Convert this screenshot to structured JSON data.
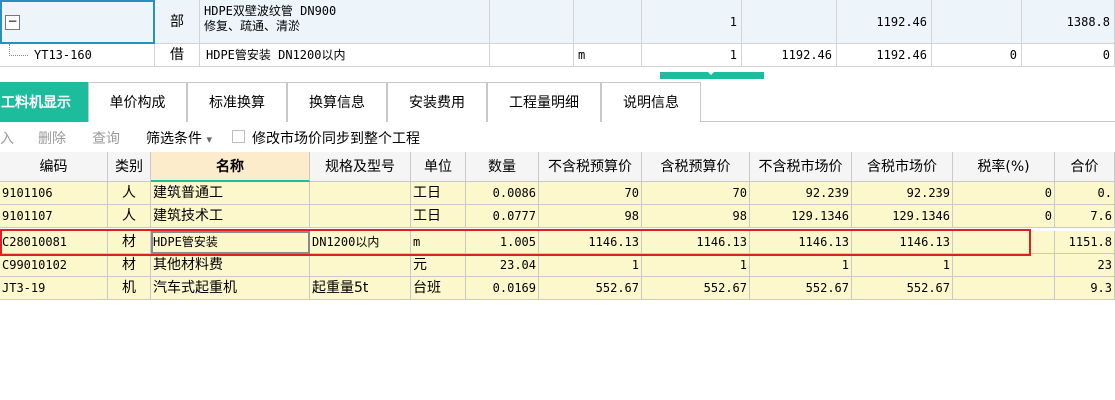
{
  "top_grid": {
    "row1": {
      "expander": "−",
      "type": "部",
      "name_line1": "HDPE双壁波纹管 DN900",
      "name_line2": "修复、疏通、清淤",
      "quantity": "1",
      "value_a": "1192.46",
      "value_b": "1388.8"
    },
    "row2": {
      "code": "YT13-160",
      "type": "借",
      "name": "HDPE管安装 DN1200以内",
      "unit": "m",
      "quantity": "1",
      "price1": "1192.46",
      "price2": "1192.46",
      "zero1": "0",
      "zero2": "0"
    }
  },
  "tabs": [
    {
      "label": "工料机显示",
      "active": true
    },
    {
      "label": "单价构成"
    },
    {
      "label": "标准换算"
    },
    {
      "label": "换算信息"
    },
    {
      "label": "安装费用"
    },
    {
      "label": "工程量明细"
    },
    {
      "label": "说明信息"
    }
  ],
  "toolbar": {
    "insert": "入",
    "delete": "删除",
    "query": "查询",
    "filter": "筛选条件",
    "filter_arrow": "▾",
    "sync_label": "修改市场价同步到整个工程"
  },
  "columns": [
    "编码",
    "类别",
    "名称",
    "规格及型号",
    "单位",
    "数量",
    "不含税预算价",
    "含税预算价",
    "不含税市场价",
    "含税市场价",
    "税率(%)",
    "合价"
  ],
  "rows": [
    {
      "code": "9101106",
      "type": "人",
      "name": "建筑普通工",
      "spec": "",
      "unit": "工日",
      "qty": "0.0086",
      "p1": "70",
      "p2": "70",
      "p3": "92.239",
      "p4": "92.239",
      "tax": "0",
      "total": "0."
    },
    {
      "code": "9101107",
      "type": "人",
      "name": "建筑技术工",
      "spec": "",
      "unit": "工日",
      "qty": "0.0777",
      "p1": "98",
      "p2": "98",
      "p3": "129.1346",
      "p4": "129.1346",
      "tax": "0",
      "total": "7.6"
    },
    {
      "code": "C28010081",
      "type": "材",
      "name": "HDPE管安装",
      "spec": "DN1200以内",
      "unit": "m",
      "qty": "1.005",
      "p1": "1146.13",
      "p2": "1146.13",
      "p3": "1146.13",
      "p4": "1146.13",
      "tax": "",
      "total": "1151.8"
    },
    {
      "code": "C99010102",
      "type": "材",
      "name": "其他材料费",
      "spec": "",
      "unit": "元",
      "qty": "23.04",
      "p1": "1",
      "p2": "1",
      "p3": "1",
      "p4": "1",
      "tax": "",
      "total": "23"
    },
    {
      "code": "JT3-19",
      "type": "机",
      "name": "汽车式起重机",
      "spec": "起重量5t",
      "unit": "台班",
      "qty": "0.0169",
      "p1": "552.67",
      "p2": "552.67",
      "p3": "552.67",
      "p4": "552.67",
      "tax": "",
      "total": "9.3"
    }
  ],
  "colors": {
    "accent": "#1cbc9c",
    "highlight_row": "#fdf8cc",
    "annotation_box": "#e02020"
  }
}
